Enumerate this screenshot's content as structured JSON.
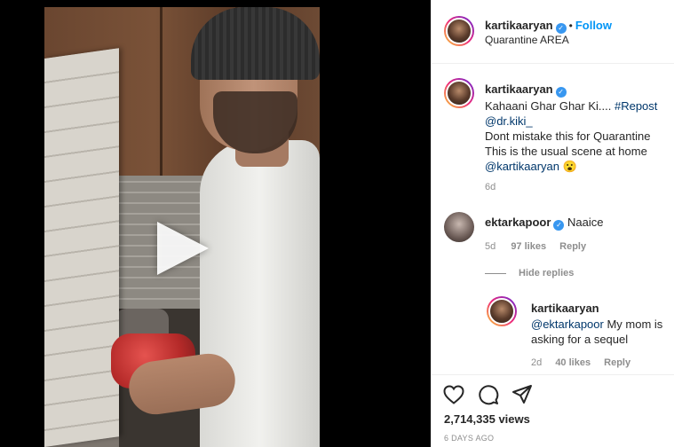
{
  "post": {
    "author": "kartikaaryan",
    "follow_label": "Follow",
    "location": "Quarantine AREA",
    "caption": {
      "author": "kartikaaryan",
      "line1_text": "Kahaani Ghar Ghar Ki.... ",
      "line1_hashtag": "#Repost",
      "mention": "@dr.kiki_",
      "line2": "Dont mistake this for Quarantine",
      "line3": "This is the usual scene at home",
      "mention2": "@kartikaaryan",
      "emoji": "😮",
      "time": "6d"
    },
    "comments": [
      {
        "author": "ektarkapoor",
        "text": "Naaice",
        "time": "5d",
        "likes": "97 likes",
        "reply_label": "Reply"
      }
    ],
    "hide_replies_label": "Hide replies",
    "replies": [
      {
        "author": "kartikaaryan",
        "mention": "@ektarkapoor",
        "text": " My mom is asking for a sequel",
        "time": "2d",
        "likes": "40 likes",
        "reply_label": "Reply"
      }
    ],
    "views": "2,714,335 views",
    "date": "6 DAYS AGO"
  },
  "icons": {
    "verified": "verified-badge-icon",
    "like": "heart-icon",
    "comment": "comment-bubble-icon",
    "share": "paper-plane-icon",
    "play": "play-icon"
  },
  "colors": {
    "link": "#00376b",
    "follow": "#0095f6",
    "verified": "#3897f0",
    "muted": "#8e8e8e"
  }
}
